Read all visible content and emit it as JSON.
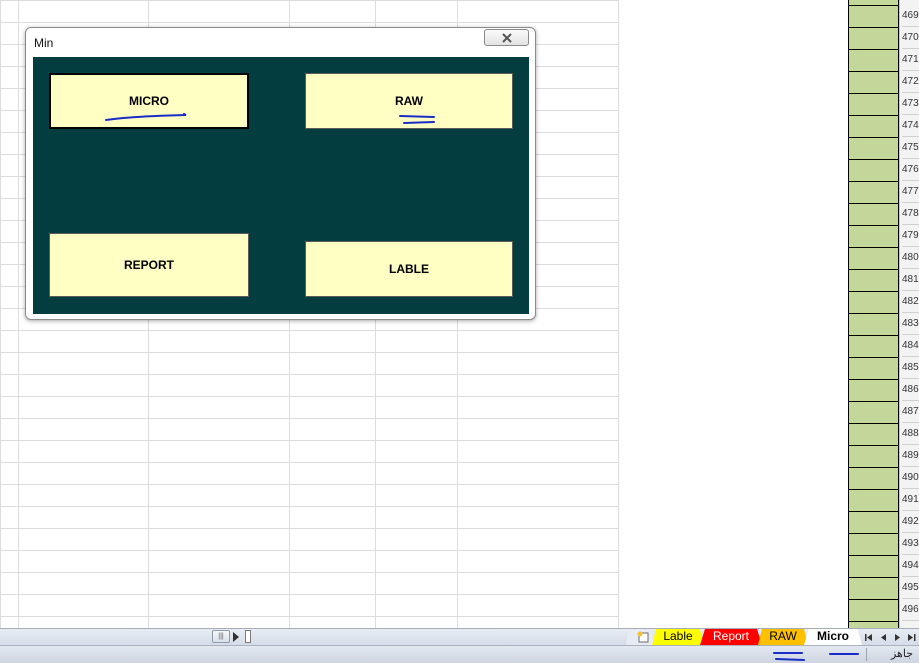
{
  "dialog": {
    "title": "Min",
    "buttons": {
      "micro": "MICRO",
      "raw": "RAW",
      "report": "REPORT",
      "lable": "LABLE"
    }
  },
  "sheet_tabs": [
    {
      "label": "Lable",
      "color": "#ffff00"
    },
    {
      "label": "Report",
      "color": "#ff0000"
    },
    {
      "label": "RAW",
      "color": "#ffc000"
    },
    {
      "label": "Micro",
      "color": "#ffffff",
      "active": true
    }
  ],
  "row_numbers": [
    "469",
    "470",
    "471",
    "472",
    "473",
    "474",
    "475",
    "476",
    "477",
    "478",
    "479",
    "480",
    "481",
    "482",
    "483",
    "484",
    "485",
    "486",
    "487",
    "488",
    "489",
    "490",
    "491",
    "492",
    "493",
    "494",
    "495",
    "496"
  ],
  "status": {
    "ready": "جاهز"
  },
  "colors": {
    "dialog_panel": "#033d40",
    "button_fill": "#ffffc3",
    "green_column": "#c4d79b",
    "annotation_ink": "#1a2cc8"
  }
}
